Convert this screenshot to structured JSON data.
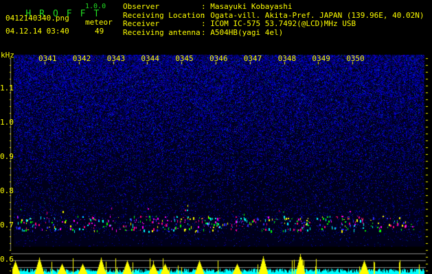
{
  "header": {
    "app_title_letters": [
      "H",
      "R",
      "O",
      "F",
      "F",
      "T"
    ],
    "version": "1.0.0",
    "filename": "0412140340.png",
    "datetime": "04.12.14 03:40",
    "meteor_label": "meteor",
    "meteor_count": "49",
    "info": [
      {
        "label": "Observer",
        "value": ": Masayuki Kobayashi"
      },
      {
        "label": "Receiving Location",
        "value": ": Ogata-vill. Akita-Pref. JAPAN (139.96E, 40.02N)"
      },
      {
        "label": "Receiver",
        "value": ": ICOM IC-575 53.7492(@LCD)MHz USB"
      },
      {
        "label": "Receiving antenna",
        "value": ": A504HB(yagi 4el)"
      }
    ]
  },
  "chart_data": {
    "type": "heatmap",
    "ylabel": "kHz",
    "x_tick_labels": [
      "0341",
      "0342",
      "0343",
      "0344",
      "0345",
      "0346",
      "0347",
      "0348",
      "0349",
      "0350"
    ],
    "y_tick_labels": [
      "1.1",
      "1.0",
      "0.9",
      "0.8",
      "0.7",
      "0.6"
    ],
    "y_ticks": [
      1.1,
      1.0,
      0.9,
      0.8,
      0.7,
      0.6
    ],
    "echo_band_khz": 0.72,
    "colors": {
      "noise": "#1a1aff",
      "text": "#ffff00",
      "histogram_peak": "#ffff00",
      "histogram_base": "#00ffff",
      "title": "#22dd22"
    }
  }
}
